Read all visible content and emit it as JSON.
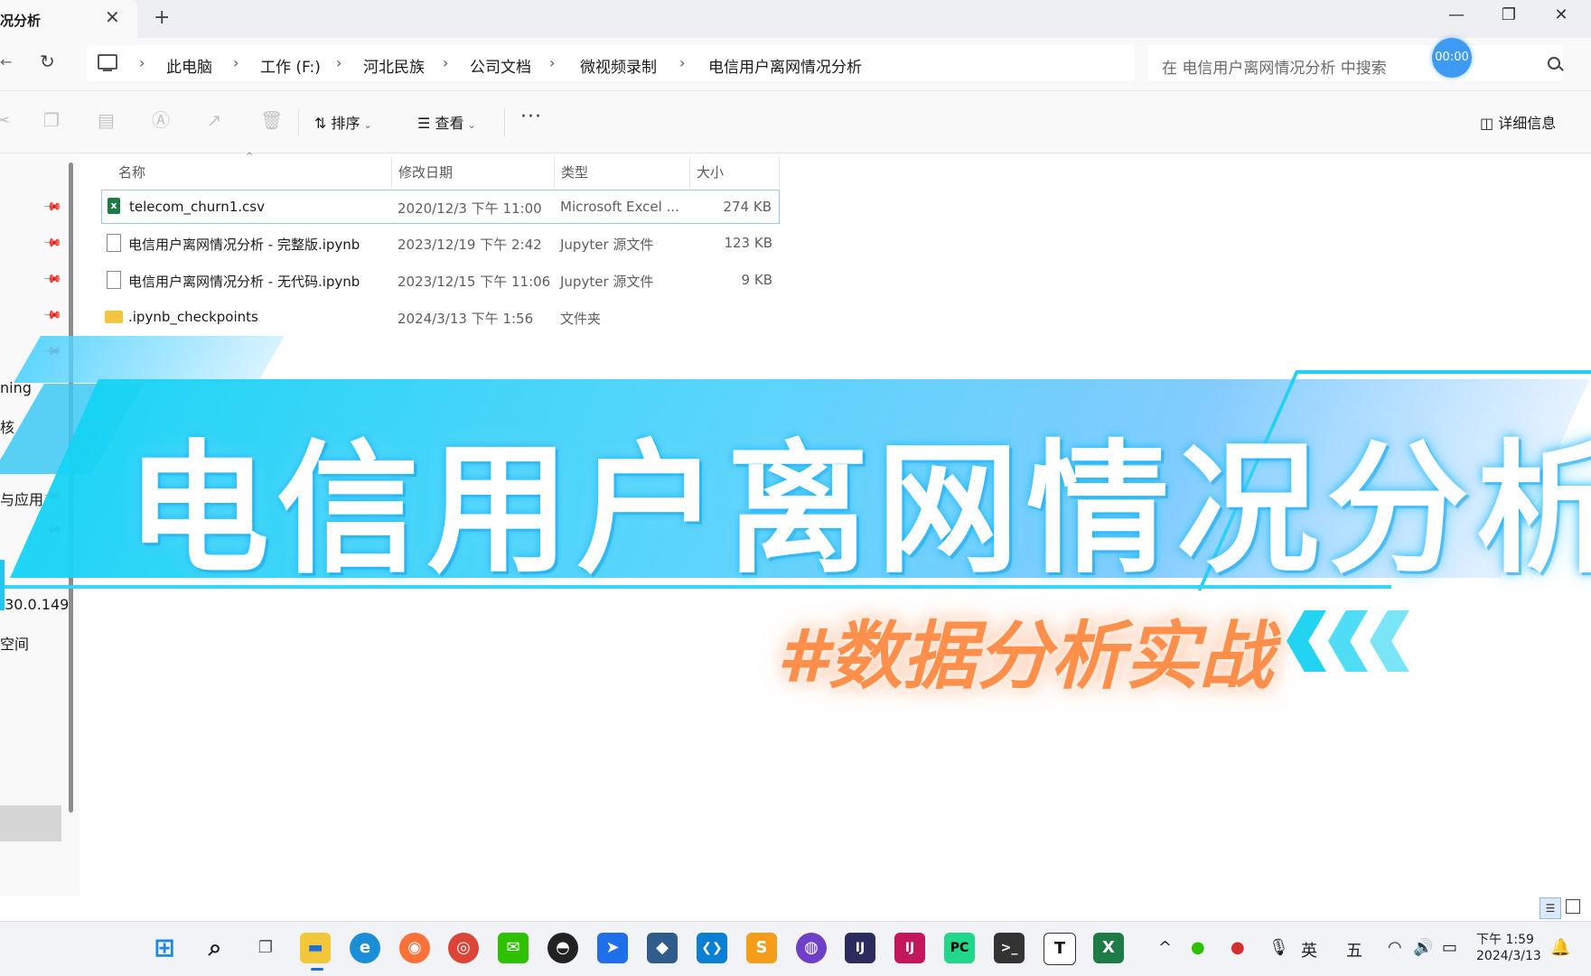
{
  "tab": {
    "title": "况分析",
    "close": "✕",
    "new": "+"
  },
  "window_controls": {
    "minimize": "—",
    "restore": "❐",
    "close": "✕"
  },
  "address": {
    "back": "←",
    "refresh": "↻",
    "breadcrumb": [
      "此电脑",
      "工作 (F:)",
      "河北民族",
      "公司文档",
      "微视频录制",
      "电信用户离网情况分析"
    ],
    "separator": "›",
    "search_placeholder": "在 电信用户离网情况分析 中搜索"
  },
  "timer": "00:00",
  "commandbar": {
    "sort_label": "排序",
    "view_label": "查看",
    "more_label": "···",
    "details_label": "详细信息",
    "disabled_icons": [
      "cut-icon",
      "copy-icon",
      "paste-icon",
      "rename-icon",
      "share-icon",
      "delete-icon"
    ],
    "disabled_glyphs": [
      "✂",
      "❐",
      "▤",
      "Ⓐ",
      "↗",
      "🗑"
    ]
  },
  "columns": {
    "name": "名称",
    "modified": "修改日期",
    "type": "类型",
    "size": "大小",
    "sort_indicator": "^"
  },
  "files": [
    {
      "name": "telecom_churn1.csv",
      "modified": "2020/12/3 下午 11:00",
      "type": "Microsoft Excel ...",
      "size": "274 KB",
      "icon": "excel-file-icon"
    },
    {
      "name": "电信用户离网情况分析 - 完整版.ipynb",
      "modified": "2023/12/19 下午 2:42",
      "type": "Jupyter 源文件",
      "size": "123 KB",
      "icon": "file-icon"
    },
    {
      "name": "电信用户离网情况分析 - 无代码.ipynb",
      "modified": "2023/12/15 下午 11:06",
      "type": "Jupyter 源文件",
      "size": "9 KB",
      "icon": "file-icon"
    },
    {
      "name": ".ipynb_checkpoints",
      "modified": "2024/3/13 下午 1:56",
      "type": "文件夹",
      "size": "",
      "icon": "folder-icon"
    }
  ],
  "navpane": {
    "labels": [
      "ning",
      "核",
      "与应用",
      ".30.0.149",
      "空间"
    ],
    "pin_glyph": "📌"
  },
  "overlay": {
    "title": "电信用户离网情况分析",
    "hashtag": "#数据分析实战"
  },
  "taskbar": {
    "apps": [
      "start-icon",
      "search-icon",
      "task-view-icon",
      "file-explorer-icon",
      "edge-icon",
      "firefox-icon",
      "chrome-icon",
      "wechat-icon",
      "qq-icon",
      "feishu-icon",
      "mysql-workbench-icon",
      "vscode-icon",
      "sublime-icon",
      "github-desktop-icon",
      "intellij-idea-icon",
      "intellij-ultimate-icon",
      "pycharm-icon",
      "terminal-icon",
      "typora-icon",
      "excel-icon"
    ],
    "app_glyphs": [
      "⊞",
      "⌕",
      "❐",
      "▬",
      "e",
      "◉",
      "◎",
      "✉",
      "◓",
      "➤",
      "◆",
      "❮❯",
      "S",
      "◍",
      "IJ",
      "IJ",
      "PC",
      ">_",
      "T",
      "X"
    ],
    "tray": {
      "chevron": "^",
      "ime_lang": "英",
      "ime_mode": "五",
      "wifi": "◠",
      "volume": "🔊",
      "battery": "▭",
      "notification": "🔔",
      "mic": "🎙"
    },
    "clock_time": "下午 1:59",
    "clock_date": "2024/3/13"
  },
  "colors": {
    "accent_blue": "#3d9bf4",
    "banner_cyan": "#15d3f4",
    "hashtag_orange": "#ff8f4a",
    "excel_green": "#1e7b45",
    "folder_yellow": "#f4c542"
  }
}
